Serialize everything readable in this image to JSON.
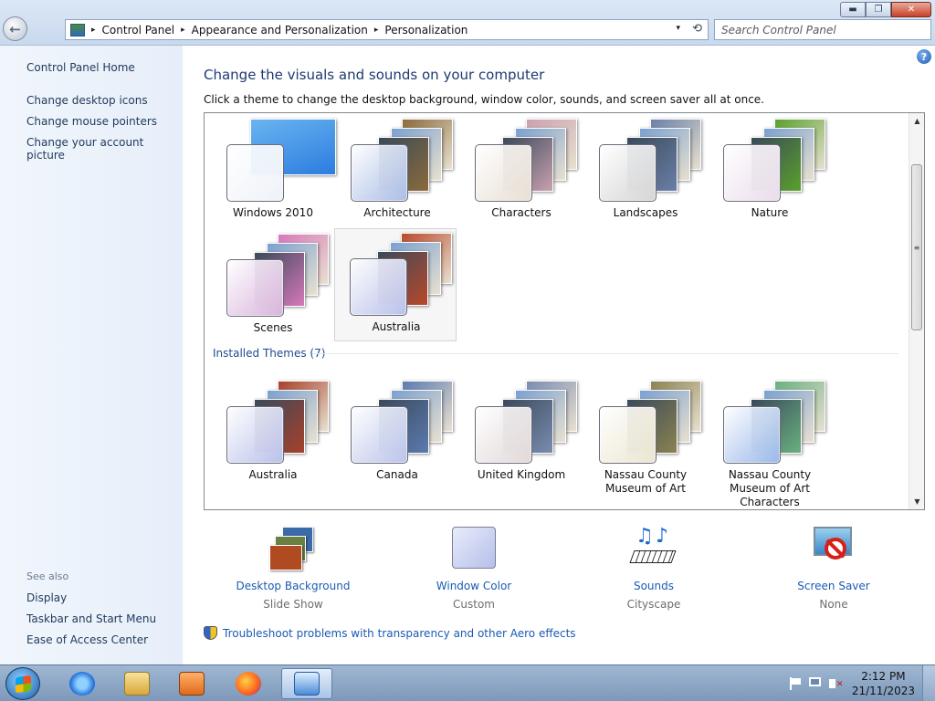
{
  "window": {
    "controls": [
      "minimize",
      "maximize",
      "close"
    ],
    "minimize_glyph": "▬",
    "maximize_glyph": "❐",
    "close_glyph": "✕"
  },
  "nav": {
    "back_glyph": "←",
    "breadcrumb": [
      "Control Panel",
      "Appearance and Personalization",
      "Personalization"
    ],
    "breadcrumb_sep": "▸",
    "dropdown_glyph": "▾",
    "refresh_glyph": "⟲"
  },
  "search": {
    "placeholder": "Search Control Panel"
  },
  "left_pane": {
    "home": "Control Panel Home",
    "tasks": [
      "Change desktop icons",
      "Change mouse pointers",
      "Change your account picture"
    ],
    "see_also_heading": "See also",
    "see_also": [
      "Display",
      "Taskbar and Start Menu",
      "Ease of Access Center"
    ]
  },
  "main": {
    "help_glyph": "?",
    "title": "Change the visuals and sounds on your computer",
    "description": "Click a theme to change the desktop background, window color, sounds, and screen saver all at once.",
    "my_themes": [
      {
        "name": "Windows 2010",
        "accent": "#2b7de0",
        "glass": "#eef2f8"
      },
      {
        "name": "Architecture",
        "accent": "#8a6a3a",
        "glass": "#a9bde6"
      },
      {
        "name": "Characters",
        "accent": "#c9a0b0",
        "glass": "#e9dfd2"
      },
      {
        "name": "Landscapes",
        "accent": "#6a7fa8",
        "glass": "#d5d5d5"
      },
      {
        "name": "Nature",
        "accent": "#5aa02c",
        "glass": "#eadcec"
      },
      {
        "name": "Scenes",
        "accent": "#d678b8",
        "glass": "#d7b4dc"
      },
      {
        "name": "Australia",
        "accent": "#b8482a",
        "glass": "#b9c1ea"
      }
    ],
    "installed_heading": "Installed Themes (7)",
    "installed_themes": [
      {
        "name": "Australia",
        "accent": "#a8402a",
        "glass": "#b9c1ea"
      },
      {
        "name": "Canada",
        "accent": "#5b7ab0",
        "glass": "#bac4ea"
      },
      {
        "name": "United Kingdom",
        "accent": "#7a8cb0",
        "glass": "#e2d8d8"
      },
      {
        "name": "Nassau County Museum of Art",
        "accent": "#8a8250",
        "glass": "#ebe5d0"
      },
      {
        "name": "Nassau County Museum of Art Characters",
        "accent": "#6ab080",
        "glass": "#9ab8ea"
      }
    ],
    "options": [
      {
        "label": "Desktop Background",
        "value": "Slide Show",
        "icon": "desktop-background-icon"
      },
      {
        "label": "Window Color",
        "value": "Custom",
        "icon": "window-color-icon"
      },
      {
        "label": "Sounds",
        "value": "Cityscape",
        "icon": "sounds-icon"
      },
      {
        "label": "Screen Saver",
        "value": "None",
        "icon": "screen-saver-icon"
      }
    ],
    "troubleshoot": "Troubleshoot problems with transparency and other Aero effects"
  },
  "taskbar": {
    "apps": [
      "internet-explorer",
      "windows-explorer",
      "media-player",
      "firefox",
      "control-panel"
    ],
    "time": "2:12 PM",
    "date": "21/11/2023"
  },
  "colors": {
    "link": "#1b5bb3",
    "title": "#1e3a70",
    "left_pane": "#eef4fb",
    "taskbar": "#8ea8c8"
  }
}
